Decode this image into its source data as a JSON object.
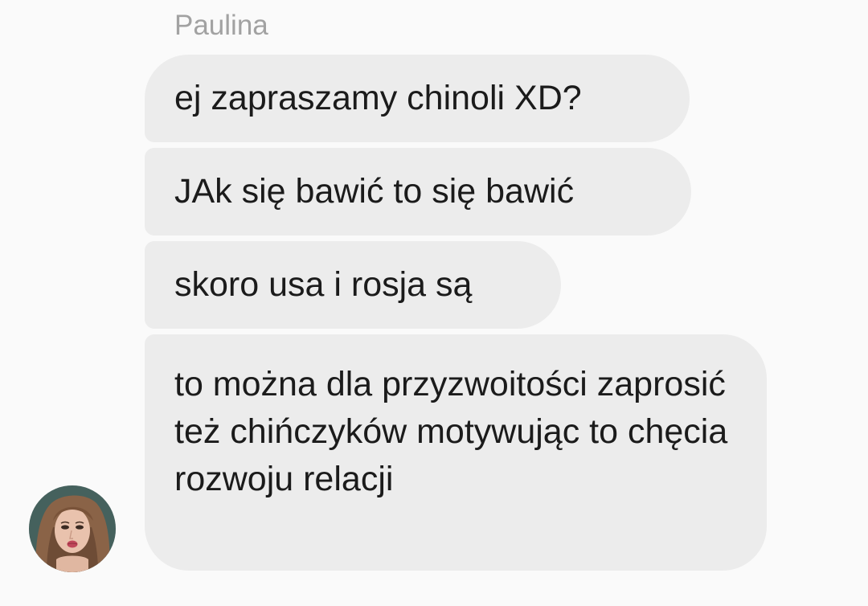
{
  "conversation": {
    "sender_name": "Paulina",
    "messages": [
      {
        "text": "ej zapraszamy chinoli XD?"
      },
      {
        "text": "JAk się bawić to się bawić"
      },
      {
        "text": "skoro usa i rosja są"
      },
      {
        "text": "to można dla przyzwoitości zaprosić też chińczyków motywując to chęcia rozwoju relacji"
      }
    ],
    "avatar": {
      "icon": "user-photo-avatar"
    }
  },
  "colors": {
    "background": "#fafafa",
    "bubble": "#ececec",
    "text": "#1b1b1b",
    "sender_name": "#a2a2a2"
  }
}
